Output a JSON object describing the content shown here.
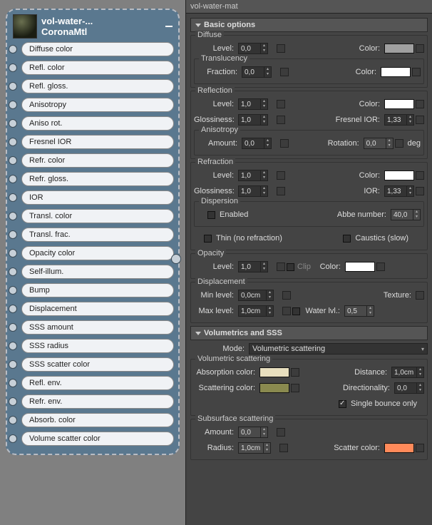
{
  "node": {
    "title": "vol-water-...",
    "subtitle": "CoronaMtl",
    "slots": [
      "Diffuse color",
      "Refl. color",
      "Refl. gloss.",
      "Anisotropy",
      "Aniso rot.",
      "Fresnel IOR",
      "Refr. color",
      "Refr. gloss.",
      "IOR",
      "Transl. color",
      "Transl. frac.",
      "Opacity color",
      "Self-illum.",
      "Bump",
      "Displacement",
      "SSS amount",
      "SSS radius",
      "SSS scatter color",
      "Refl. env.",
      "Refr. env.",
      "Absorb. color",
      "Volume scatter color"
    ]
  },
  "tab": "vol-water-mat",
  "rollouts": {
    "basic": "Basic options",
    "vol": "Volumetrics and SSS"
  },
  "groups": {
    "diffuse": "Diffuse",
    "translucency": "Translucency",
    "reflection": "Reflection",
    "anisotropy": "Anisotropy",
    "refraction": "Refraction",
    "dispersion": "Dispersion",
    "opacity": "Opacity",
    "displacement": "Displacement",
    "volscat": "Volumetric scattering",
    "sss": "Subsurface scattering"
  },
  "labels": {
    "level": "Level:",
    "color": "Color:",
    "fraction": "Fraction:",
    "glossiness": "Glossiness:",
    "fresnel": "Fresnel IOR:",
    "amount": "Amount:",
    "rotation": "Rotation:",
    "deg": "deg",
    "ior": "IOR:",
    "enabled": "Enabled",
    "abbe": "Abbe number:",
    "thin": "Thin (no refraction)",
    "caustics": "Caustics (slow)",
    "clip": "Clip",
    "minlevel": "Min level:",
    "maxlevel": "Max level:",
    "texture": "Texture:",
    "waterlvl": "Water lvl.:",
    "mode": "Mode:",
    "absorbcol": "Absorption color:",
    "scatcol": "Scattering color:",
    "distance": "Distance:",
    "direction": "Directionality:",
    "singlebounce": "Single bounce only",
    "radius": "Radius:",
    "scattercolor": "Scatter color:"
  },
  "values": {
    "diffuseLevel": "0,0",
    "diffuseColor": "#a0a0a0",
    "translFrac": "0,0",
    "translColor": "#ffffff",
    "reflLevel": "1,0",
    "reflColor": "#ffffff",
    "reflGloss": "1,0",
    "fresnelIOR": "1,33",
    "anisoAmount": "0,0",
    "anisoRot": "0,0",
    "refrLevel": "1,0",
    "refrColor": "#ffffff",
    "refrGloss": "1,0",
    "refrIOR": "1,33",
    "abbe": "40,0",
    "opacityLevel": "1,0",
    "opacityColor": "#ffffff",
    "dispMin": "0,0cm",
    "dispMax": "1,0cm",
    "waterLvl": "0,5",
    "mode": "Volumetric scattering",
    "absorbColor": "#e8dfbf",
    "scatColor": "#8a8a4f",
    "distance": "1,0cm",
    "directionality": "0,0",
    "sssAmount": "0,0",
    "sssRadius": "1,0cm",
    "sssScatter": "#ff8a5a"
  },
  "checks": {
    "dispersion": false,
    "thin": false,
    "caustics": false,
    "clip": false,
    "waterlvl": false,
    "singlebounce": true
  }
}
